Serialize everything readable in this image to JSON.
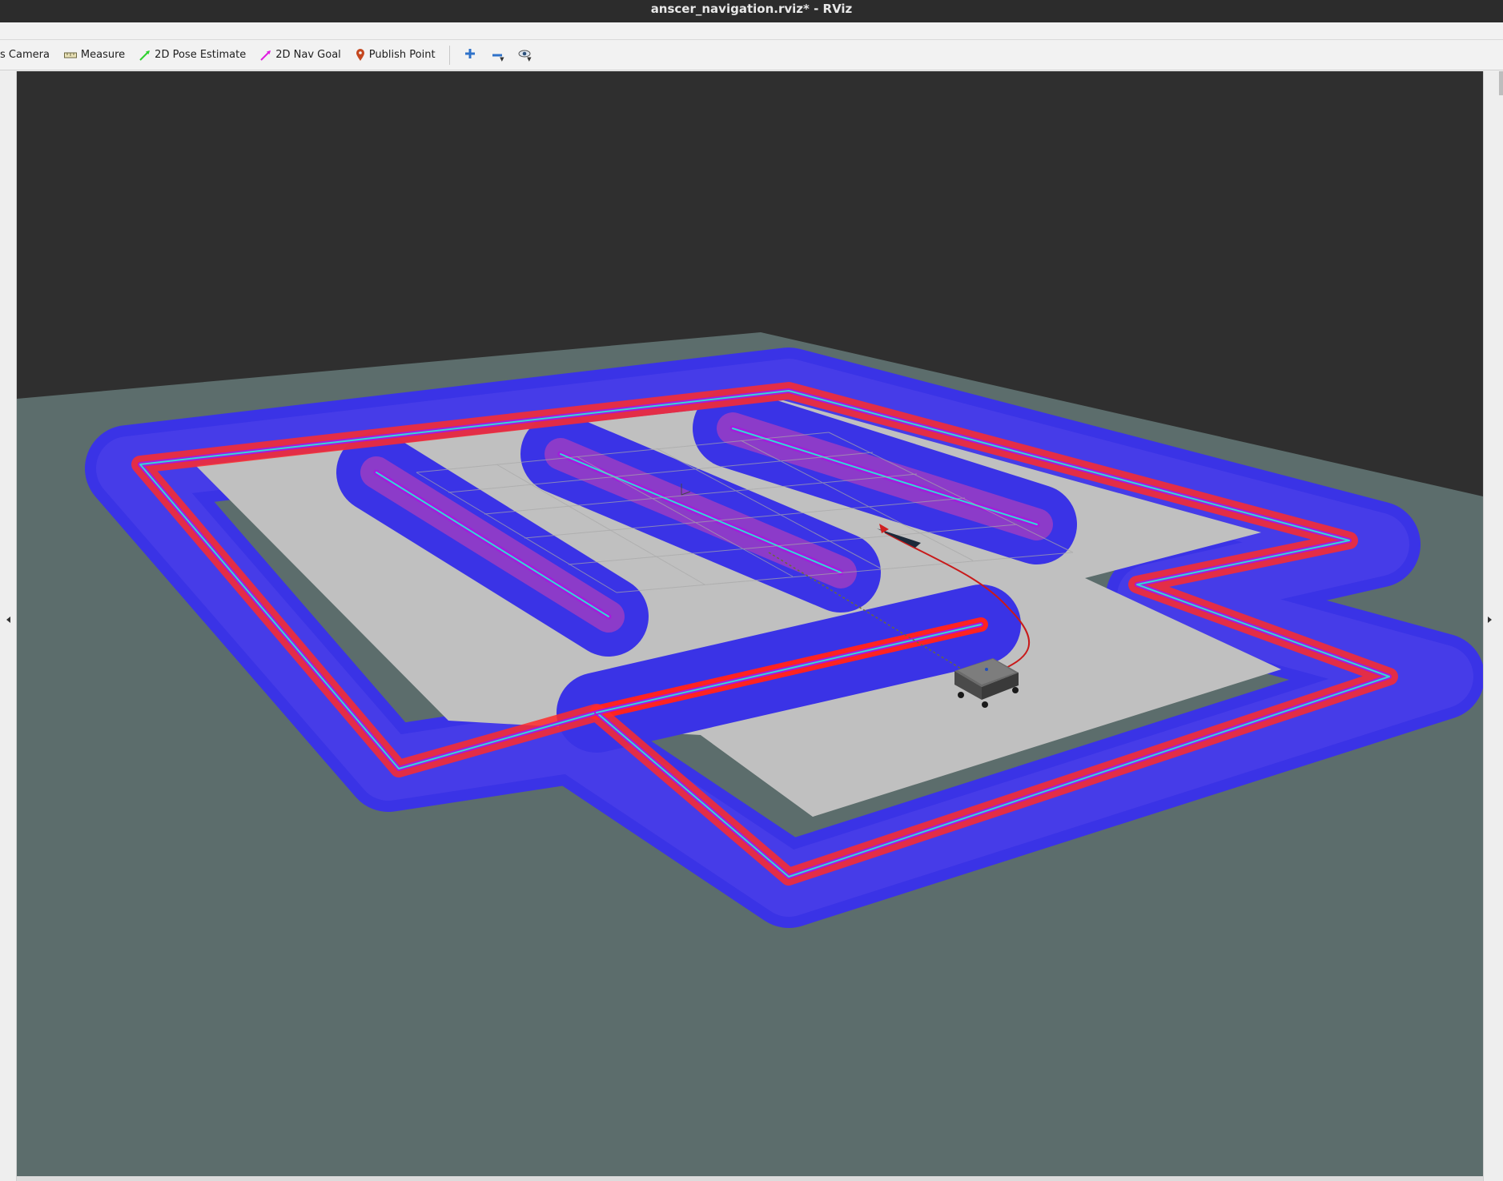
{
  "window": {
    "title": "anscer_navigation.rviz* - RViz"
  },
  "toolbar": {
    "tools": [
      {
        "label": "s Camera",
        "icon": "camera-icon"
      },
      {
        "label": "Measure",
        "icon": "ruler-icon"
      },
      {
        "label": "2D Pose Estimate",
        "icon": "green-arrow-icon"
      },
      {
        "label": "2D Nav Goal",
        "icon": "magenta-arrow-icon"
      },
      {
        "label": "Publish Point",
        "icon": "map-pin-icon"
      }
    ],
    "icon_buttons": [
      "add-tool-icon",
      "remove-tool-icon",
      "view-eye-icon"
    ]
  },
  "colors": {
    "background": "#2f2f2f",
    "ground_plane": "#5c6d6c",
    "free_space": "#c0c0c0",
    "costmap_outer": "#3a33e6",
    "costmap_inner": "#ff2222",
    "wall_line": "#a41cdc",
    "laser": "#35d6d6",
    "path": "#c81a1a"
  }
}
